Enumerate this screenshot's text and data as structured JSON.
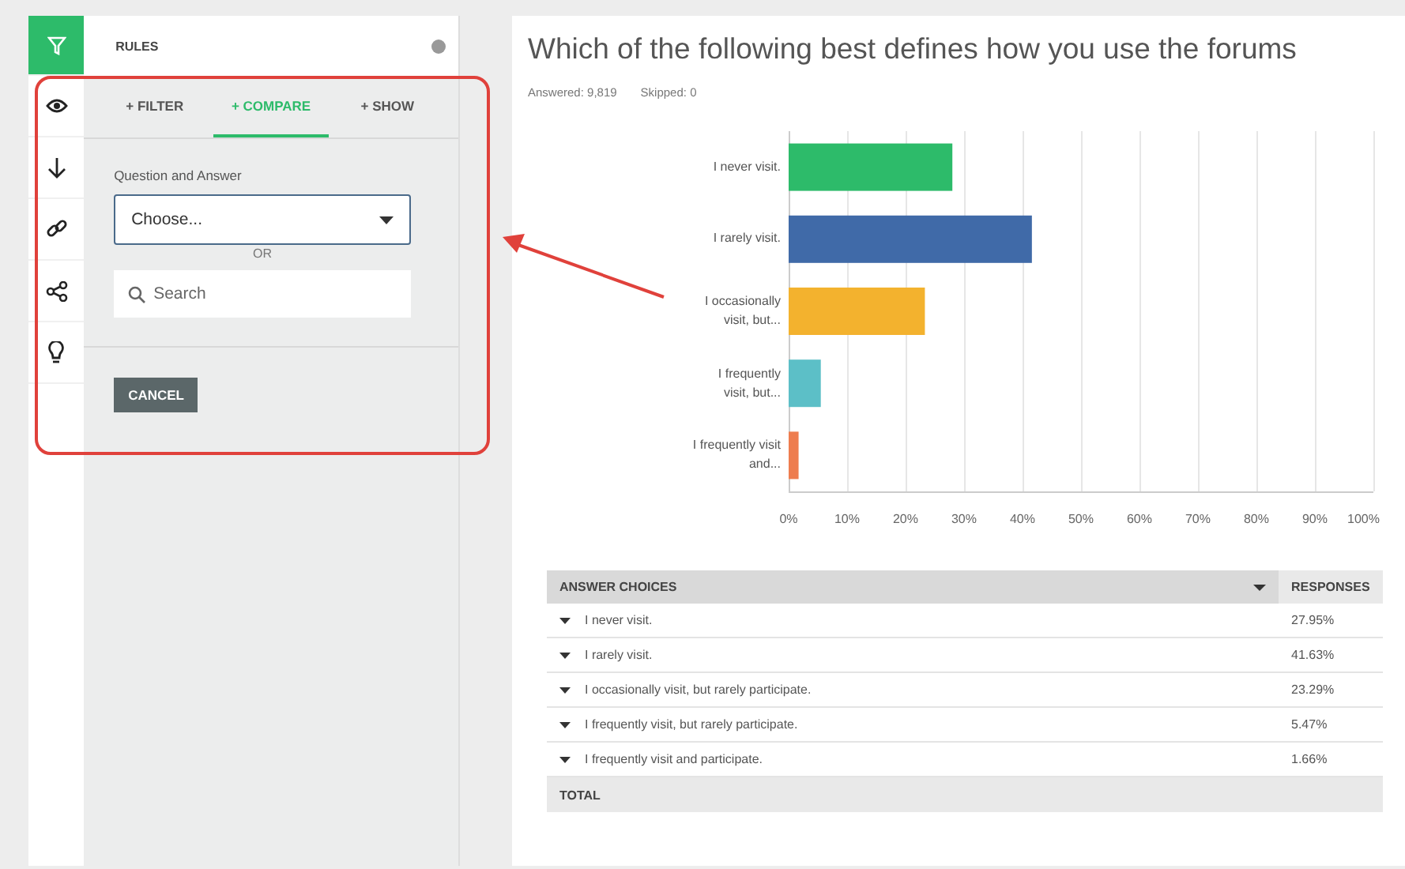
{
  "rail": [
    {
      "selected": true
    },
    {
      "selected": false
    },
    {
      "selected": false
    },
    {
      "selected": false
    },
    {
      "selected": false
    },
    {
      "selected": false
    }
  ],
  "rules_panel": {
    "title": "RULES",
    "tabs": [
      {
        "label": "+ FILTER",
        "selected": false
      },
      {
        "label": "+ COMPARE",
        "selected": true
      },
      {
        "label": "+ SHOW",
        "selected": false
      }
    ],
    "field_label": "Question and Answer",
    "select": {
      "value": "Choose..."
    },
    "separator": "OR",
    "search": {
      "placeholder": "Search"
    },
    "cancel_button": "CANCEL"
  },
  "question": {
    "title": "Which of the following best defines how you use the forums",
    "answered": "Answered: 9,819",
    "skipped": "Skipped: 0",
    "chart_data": {
      "type": "bar",
      "orientation": "horizontal",
      "categories": [
        "I never visit.",
        "I rarely visit.",
        "I occasionally visit, but...",
        "I frequently visit, but...",
        "I frequently visit and..."
      ],
      "values": [
        28,
        41.6,
        23.3,
        5.5,
        1.7
      ],
      "colors": [
        "#2dbb6a",
        "#406aa8",
        "#f3b22e",
        "#5cbfc7",
        "#ee7d4f"
      ],
      "xlim": [
        0,
        100
      ],
      "grid": true,
      "xticks": [
        {
          "value": 0,
          "label": "0%"
        },
        {
          "value": 10,
          "label": "10%"
        },
        {
          "value": 20,
          "label": "20%"
        },
        {
          "value": 30,
          "label": "30%"
        },
        {
          "value": 40,
          "label": "40%"
        },
        {
          "value": 50,
          "label": "50%"
        },
        {
          "value": 60,
          "label": "60%"
        },
        {
          "value": 70,
          "label": "70%"
        },
        {
          "value": 80,
          "label": "80%"
        },
        {
          "value": 90,
          "label": "90%"
        },
        {
          "value": 100,
          "label": "100%"
        }
      ]
    }
  },
  "table": {
    "columns": [
      "ANSWER CHOICES",
      "RESPONSES"
    ],
    "rows": [
      {
        "choice": "I never visit.",
        "response": "27.95%"
      },
      {
        "choice": "I rarely visit.",
        "response": "41.63%"
      },
      {
        "choice": "I occasionally visit, but rarely participate.",
        "response": "23.29%"
      },
      {
        "choice": "I frequently visit, but rarely participate.",
        "response": "5.47%"
      },
      {
        "choice": "I frequently visit and participate.",
        "response": "1.66%"
      }
    ],
    "total": "TOTAL"
  }
}
